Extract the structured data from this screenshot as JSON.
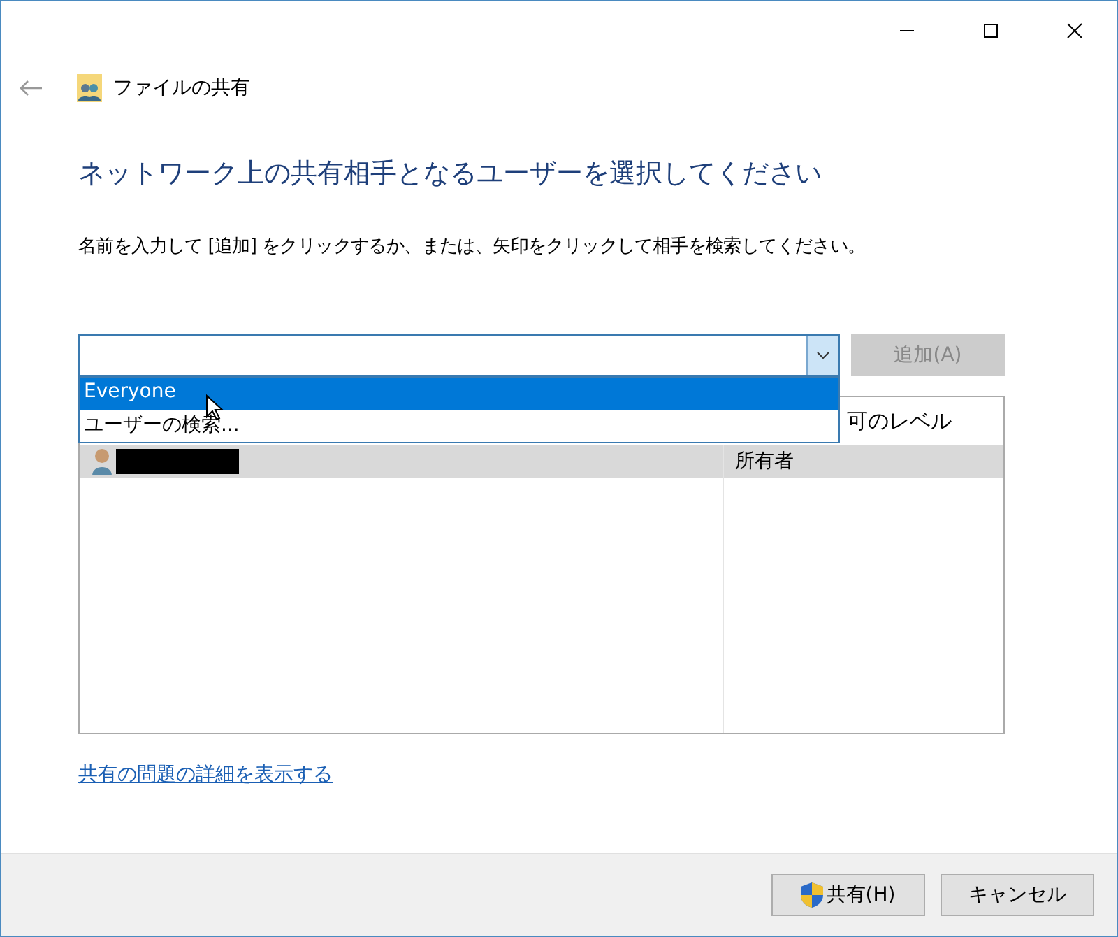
{
  "window": {
    "title": "ファイルの共有"
  },
  "heading": "ネットワーク上の共有相手となるユーザーを選択してください",
  "instruction": "名前を入力して [追加] をクリックするか、または、矢印をクリックして相手を検索してください。",
  "name_combo": {
    "expanded": true
  },
  "add_button": {
    "label": "追加(A)",
    "disabled": true
  },
  "dropdown": [
    {
      "label": "Everyone",
      "selected": true
    },
    {
      "label": "ユーザーの検索...",
      "selected": false
    }
  ],
  "table": {
    "columns": [
      {
        "label": "可のレベル"
      }
    ],
    "rows": [
      {
        "level_text": "所有者",
        "redacted": true,
        "selected": true
      }
    ]
  },
  "details_link": "共有の問題の詳細を表示する",
  "buttons": [
    {
      "label": "共有(H)",
      "kind": "shield"
    },
    {
      "label": "キャンセル",
      "kind": "plain"
    }
  ]
}
